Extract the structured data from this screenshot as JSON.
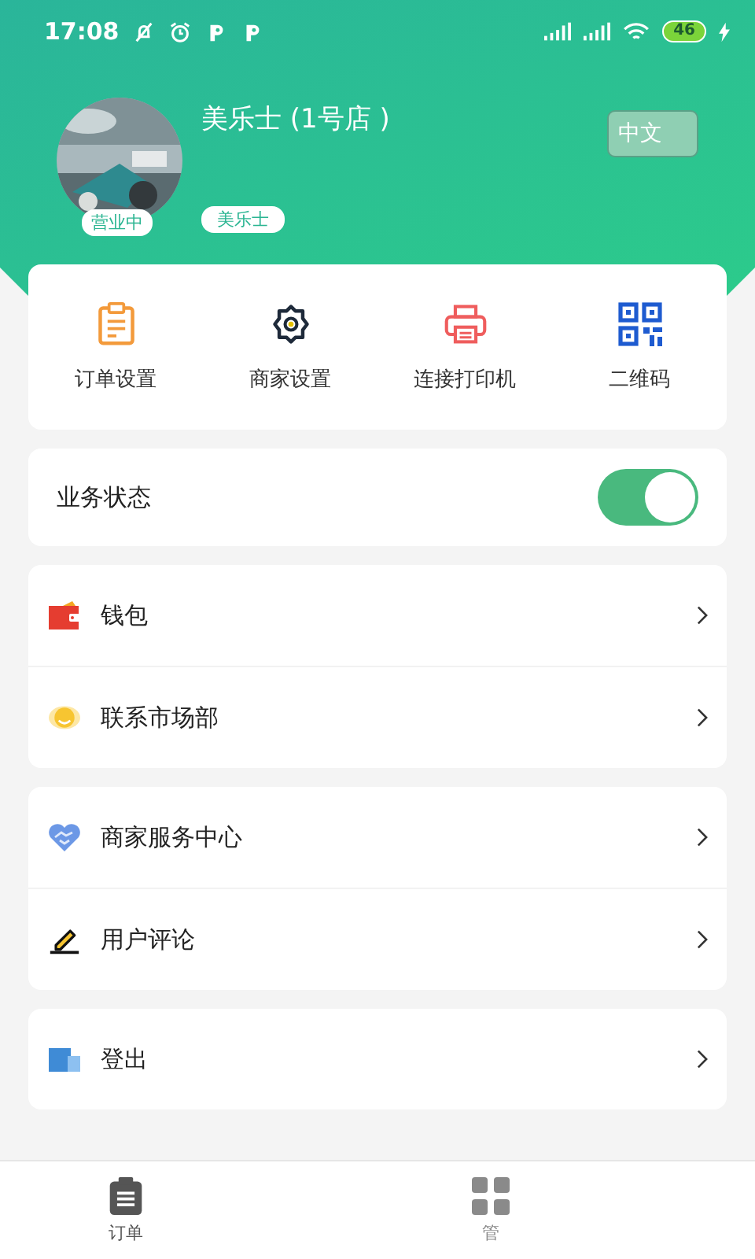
{
  "status_bar": {
    "time": "17:08",
    "battery": "46"
  },
  "profile": {
    "name": "美乐士 (1号店 )",
    "status_badge": "营业中",
    "tag": "美乐士",
    "language_button": "中文"
  },
  "shortcuts": [
    {
      "label": "订单设置",
      "kind": "clipboard"
    },
    {
      "label": "商家设置",
      "kind": "gear"
    },
    {
      "label": "连接打印机",
      "kind": "printer"
    },
    {
      "label": "二维码",
      "kind": "qr"
    }
  ],
  "business_status": {
    "label": "业务状态",
    "on": true
  },
  "menu_groups": [
    [
      {
        "label": "钱包",
        "kind": "wallet"
      },
      {
        "label": "联系市场部",
        "kind": "headset"
      }
    ],
    [
      {
        "label": "商家服务中心",
        "kind": "handshake"
      },
      {
        "label": "用户评论",
        "kind": "pen"
      }
    ],
    [
      {
        "label": "登出",
        "kind": "logout"
      }
    ]
  ],
  "tab_bar": [
    {
      "label": "订单",
      "kind": "orders",
      "selected": true
    },
    {
      "label": "管",
      "kind": "manage",
      "selected": false
    }
  ]
}
